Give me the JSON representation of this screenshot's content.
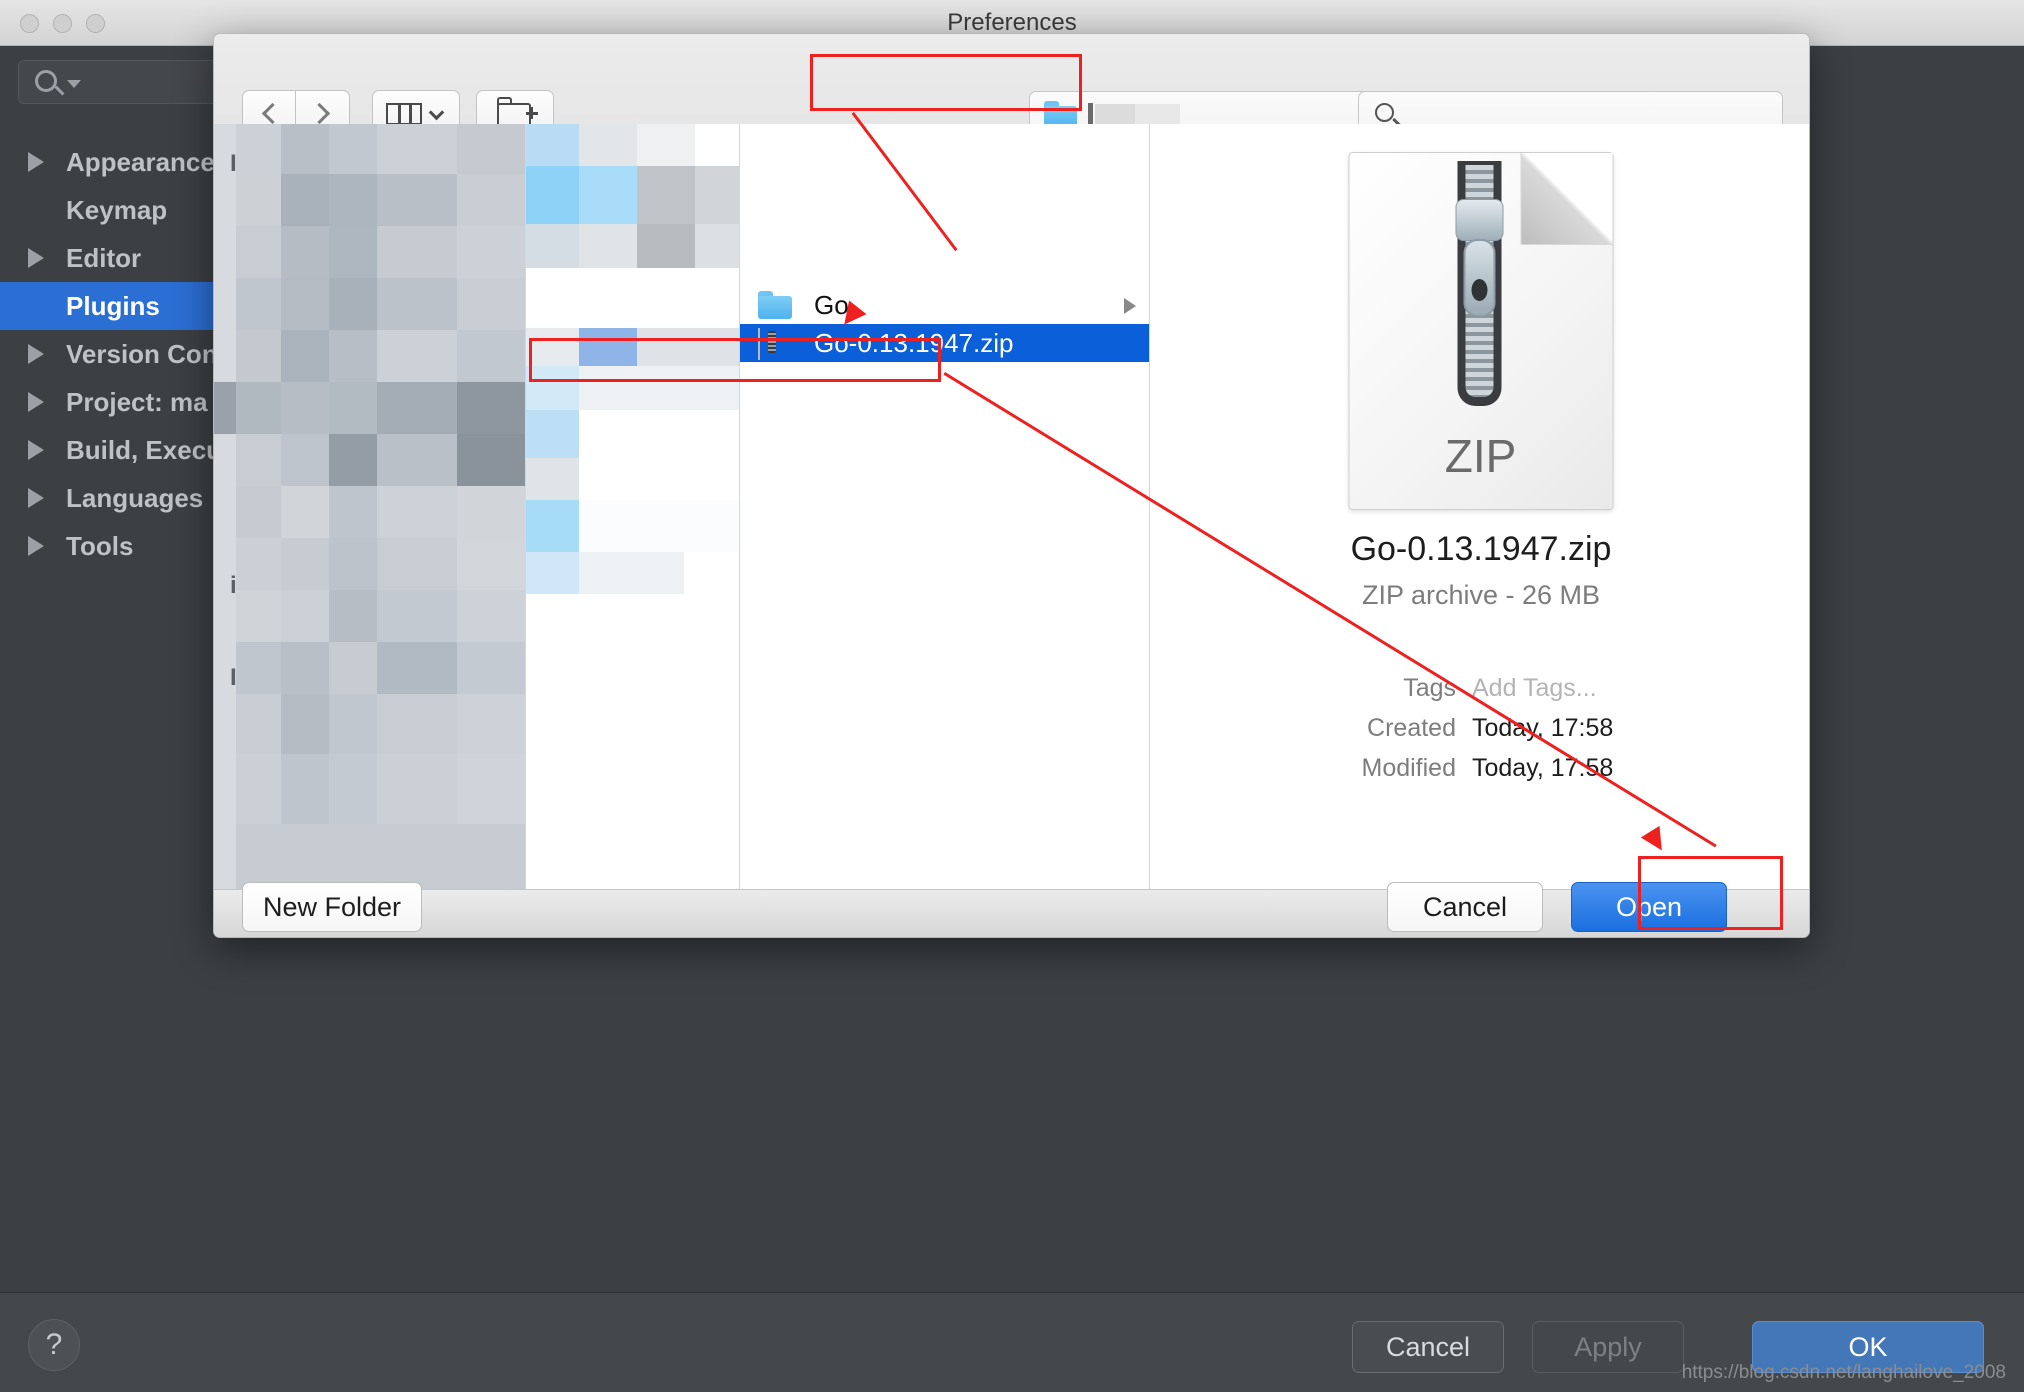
{
  "window": {
    "title": "Preferences",
    "traffic_lights": [
      "close",
      "minimize",
      "zoom"
    ]
  },
  "prefs_sidebar": {
    "search_placeholder": "",
    "items": [
      {
        "label": "Appearance & Behavior",
        "expandable": true,
        "selected": false
      },
      {
        "label": "Keymap",
        "expandable": false,
        "selected": false
      },
      {
        "label": "Editor",
        "expandable": true,
        "selected": false
      },
      {
        "label": "Plugins",
        "expandable": false,
        "selected": true
      },
      {
        "label": "Version Control",
        "expandable": true,
        "selected": false
      },
      {
        "label": "Project: ma",
        "expandable": true,
        "selected": false
      },
      {
        "label": "Build, Execution",
        "expandable": true,
        "selected": false
      },
      {
        "label": "Languages",
        "expandable": true,
        "selected": false
      },
      {
        "label": "Tools",
        "expandable": true,
        "selected": false
      }
    ]
  },
  "prefs_bottom": {
    "help_label": "?",
    "cancel_label": "Cancel",
    "apply_label": "Apply",
    "ok_label": "OK"
  },
  "watermark": "https://blog.csdn.net/langhailove_2008",
  "file_dialog": {
    "toolbar": {
      "back_label": "Back",
      "forward_label": "Forward",
      "view_mode_label": "Column View",
      "new_folder_tb_label": "New Folder",
      "path_name": "",
      "search_placeholder": ""
    },
    "column3": {
      "rows": [
        {
          "name": "Go",
          "type": "folder",
          "selected": false,
          "has_disclosure": true
        },
        {
          "name": "Go-0.13.1947.zip",
          "type": "zip",
          "selected": true,
          "has_disclosure": false
        }
      ]
    },
    "preview": {
      "icon_label": "ZIP",
      "title": "Go-0.13.1947.zip",
      "subtitle": "ZIP archive - 26 MB",
      "meta": [
        {
          "key": "Tags",
          "value": "Add Tags...",
          "dim": true
        },
        {
          "key": "Created",
          "value": "Today, 17:58",
          "dim": false
        },
        {
          "key": "Modified",
          "value": "Today, 17:58",
          "dim": false
        }
      ]
    },
    "footer": {
      "new_folder_label": "New Folder",
      "cancel_label": "Cancel",
      "open_label": "Open"
    }
  },
  "colors": {
    "accent_blue": "#0b5fd8",
    "open_button_blue": "#1a6fe0",
    "sidebar_selection": "#2b6ed4",
    "annotation_red": "#ee2020",
    "ide_dark": "#3c4043"
  }
}
